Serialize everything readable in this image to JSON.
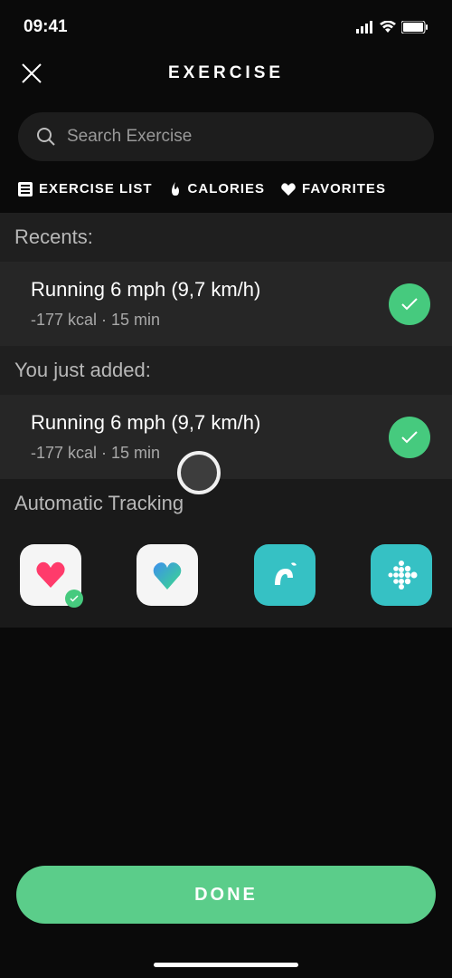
{
  "status": {
    "time": "09:41"
  },
  "header": {
    "title": "EXERCISE"
  },
  "search": {
    "placeholder": "Search Exercise"
  },
  "tabs": {
    "exercise_list": "EXERCISE LIST",
    "calories": "CALORIES",
    "favorites": "FAVORITES"
  },
  "sections": {
    "recents": {
      "header": "Recents:",
      "items": [
        {
          "title": "Running 6 mph (9,7 km/h)",
          "meta": "-177 kcal · 15 min",
          "checked": true
        }
      ]
    },
    "just_added": {
      "header": "You just added:",
      "items": [
        {
          "title": "Running 6 mph (9,7 km/h)",
          "meta": "-177 kcal · 15 min",
          "checked": true
        }
      ]
    },
    "automatic_tracking": {
      "header": "Automatic Tracking"
    }
  },
  "done_button": "DONE",
  "colors": {
    "accent": "#46ca7e",
    "button": "#5bcd8a"
  }
}
